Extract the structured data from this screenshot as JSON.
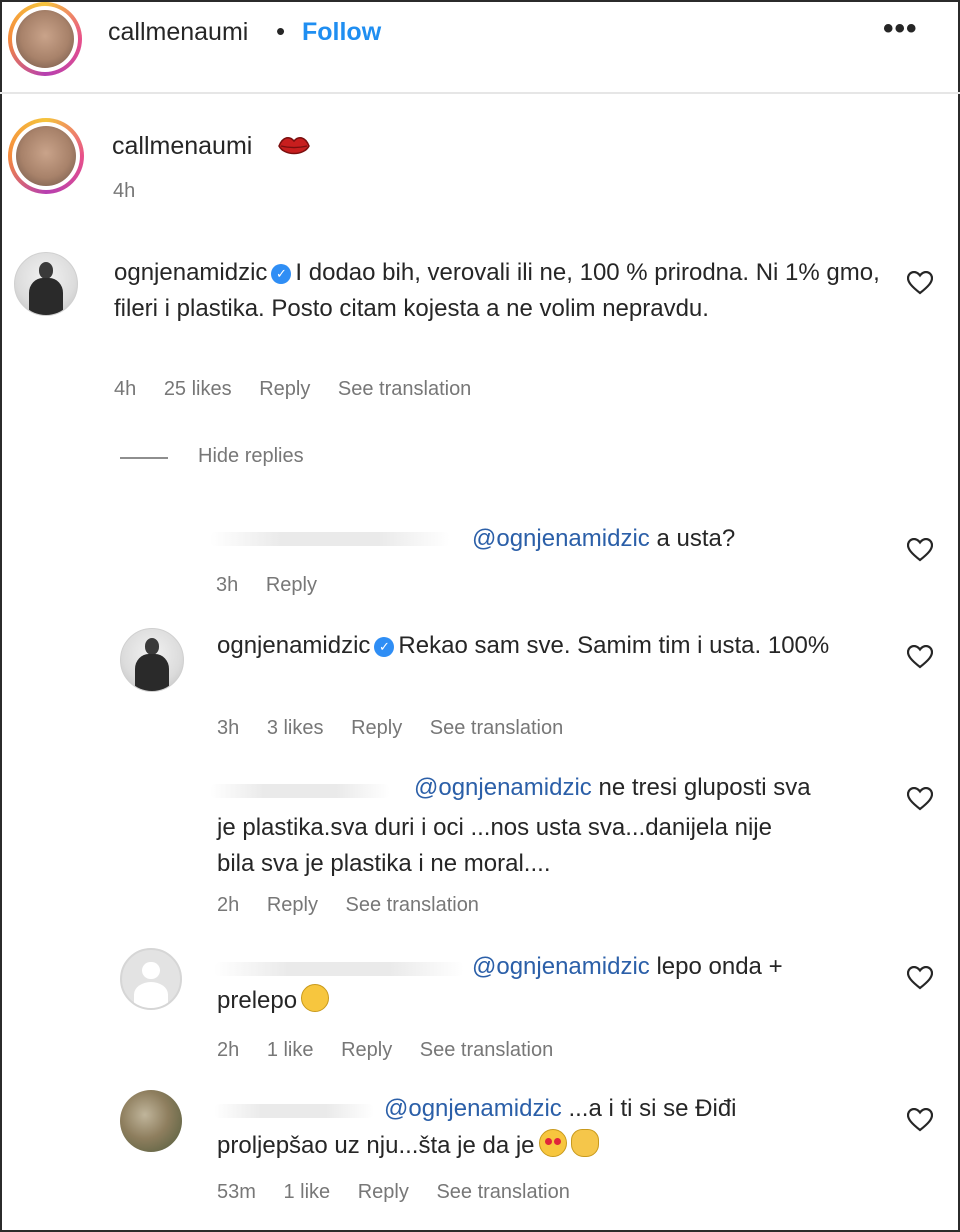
{
  "header": {
    "username": "callmenaumi",
    "separator": "•",
    "follow": "Follow",
    "more": "•••"
  },
  "caption": {
    "username": "callmenaumi",
    "emoji_icon": "kiss-lips-icon",
    "time": "4h"
  },
  "hide_replies": "Hide replies",
  "comments": [
    {
      "username": "ognjenamidzic",
      "verified": true,
      "text": "I dodao bih, verovali ili ne, 100 % prirodna. Ni 1% gmo, fileri i plastika. Posto citam kojesta a ne volim nepravdu.",
      "time": "4h",
      "likes": "25 likes",
      "reply": "Reply",
      "translation": "See translation"
    },
    {
      "mention": "@ognjenamidzic",
      "text": "a usta?",
      "time": "3h",
      "reply": "Reply"
    },
    {
      "username": "ognjenamidzic",
      "verified": true,
      "text": "Rekao sam sve. Samim tim i usta. 100%",
      "time": "3h",
      "likes": "3 likes",
      "reply": "Reply",
      "translation": "See translation"
    },
    {
      "mention": "@ognjenamidzic",
      "text_line1": "ne tresi gluposti sva",
      "text_line2": "je plastika.sva duri i oci ...nos usta sva...danijela nije",
      "text_line3": "bila sva je plastika i ne moral....",
      "time": "2h",
      "reply": "Reply",
      "translation": "See translation"
    },
    {
      "mention": "@ognjenamidzic",
      "text_line1": "lepo onda +",
      "text_line2": "prelepo",
      "time": "2h",
      "likes": "1 like",
      "reply": "Reply",
      "translation": "See translation"
    },
    {
      "mention": "@ognjenamidzic",
      "text_line1": "...a i ti si se Điđi",
      "text_line2": "proljepšao uz nju...šta je da je",
      "time": "53m",
      "likes": "1 like",
      "reply": "Reply",
      "translation": "See translation"
    }
  ]
}
